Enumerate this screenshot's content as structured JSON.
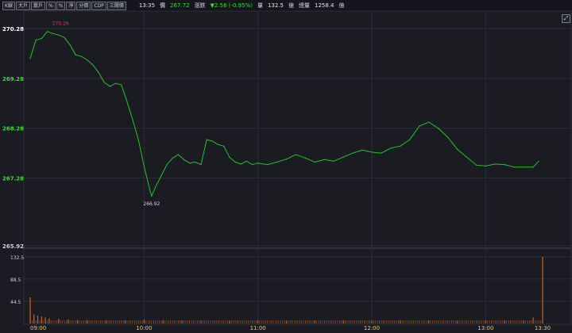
{
  "toolbar": {
    "tabs": [
      "K線",
      "大戶",
      "散戶",
      "%",
      "%",
      "淨",
      "分價",
      "CDP",
      "三關價"
    ],
    "time": "13:35",
    "price_label": "價",
    "price_value": "267.72",
    "change_label": "漲跌",
    "change_value": "▼2.56 (-0.95%)",
    "volume_label": "量",
    "volume_value": "132.5",
    "volume_unit": "億",
    "total_label": "總量",
    "total_value": "1258.4",
    "total_unit": "億"
  },
  "colors": {
    "background": "#1b1b22",
    "grid": "#2c2c36",
    "price_line": "#22c22a",
    "volume_bar": "#c8642a",
    "high_label": "#e0356b",
    "low_label": "#cfd3dc",
    "axis_label_green": "#33e033",
    "axis_label_white": "#ffffff"
  },
  "chart_data": [
    {
      "type": "line",
      "y_ticks": [
        "270.28",
        "269.28",
        "268.28",
        "267.28",
        "265.92"
      ],
      "ylim": [
        265.92,
        270.28
      ],
      "x_ticks": [
        "09:00",
        "10:00",
        "11:00",
        "12:00",
        "13:00",
        "13:30"
      ],
      "annotations": [
        {
          "text": "270.26",
          "time": "09:16",
          "value": 270.26,
          "kind": "high"
        },
        {
          "text": "266.92",
          "time": "10:04",
          "value": 266.92,
          "kind": "low"
        }
      ],
      "series": [
        {
          "x": [
            "09:00",
            "09:03",
            "09:06",
            "09:09",
            "09:12",
            "09:15",
            "09:18",
            "09:21",
            "09:24",
            "09:27",
            "09:30",
            "09:33",
            "09:36",
            "09:39",
            "09:42",
            "09:45",
            "09:48",
            "09:51",
            "09:54",
            "09:57",
            "10:00",
            "10:03",
            "10:04",
            "10:06",
            "10:09",
            "10:12",
            "10:15",
            "10:18",
            "10:21",
            "10:24",
            "10:27",
            "10:30",
            "10:33",
            "10:36",
            "10:39",
            "10:42",
            "10:45",
            "10:48",
            "10:51",
            "10:54",
            "10:57",
            "11:00",
            "11:05",
            "11:10",
            "11:15",
            "11:20",
            "11:25",
            "11:30",
            "11:35",
            "11:40",
            "11:45",
            "11:50",
            "11:55",
            "12:00",
            "12:05",
            "12:10",
            "12:15",
            "12:20",
            "12:25",
            "12:30",
            "12:35",
            "12:40",
            "12:45",
            "12:50",
            "12:55",
            "13:00",
            "13:05",
            "13:10",
            "13:15",
            "13:20",
            "13:25",
            "13:28"
          ],
          "values": [
            269.68,
            270.05,
            270.08,
            270.22,
            270.18,
            270.15,
            270.1,
            269.95,
            269.75,
            269.72,
            269.65,
            269.55,
            269.4,
            269.2,
            269.12,
            269.18,
            269.15,
            268.82,
            268.45,
            268.05,
            267.52,
            267.05,
            266.92,
            267.1,
            267.32,
            267.55,
            267.68,
            267.75,
            267.65,
            267.58,
            267.6,
            267.55,
            268.05,
            268.02,
            267.95,
            267.92,
            267.7,
            267.6,
            267.56,
            267.62,
            267.55,
            267.58,
            267.55,
            267.6,
            267.66,
            267.75,
            267.68,
            267.6,
            267.65,
            267.62,
            267.7,
            267.78,
            267.84,
            267.8,
            267.78,
            267.88,
            267.92,
            268.05,
            268.32,
            268.4,
            268.28,
            268.1,
            267.86,
            267.7,
            267.54,
            267.52,
            267.56,
            267.55,
            267.5,
            267.5,
            267.5,
            267.62
          ]
        }
      ]
    },
    {
      "type": "bar",
      "y_ticks": [
        "132.5",
        "88.5",
        "44.5"
      ],
      "ylim": [
        0,
        132.5
      ],
      "series": [
        {
          "x": [
            "09:00",
            "09:02",
            "09:04",
            "09:06",
            "09:08",
            "09:10",
            "09:15",
            "09:20",
            "09:25",
            "09:30",
            "09:40",
            "09:50",
            "10:00",
            "10:10",
            "10:20",
            "10:30",
            "10:45",
            "11:00",
            "11:15",
            "11:30",
            "11:45",
            "12:00",
            "12:15",
            "12:30",
            "12:45",
            "13:00",
            "13:10",
            "13:20",
            "13:25",
            "13:30"
          ],
          "values": [
            52,
            18,
            16,
            14,
            12,
            10,
            9,
            8,
            7,
            7,
            6,
            6,
            8,
            7,
            6,
            5,
            5,
            6,
            5,
            6,
            5,
            5,
            5,
            6,
            5,
            5,
            6,
            6,
            12,
            132.5
          ]
        }
      ]
    }
  ]
}
